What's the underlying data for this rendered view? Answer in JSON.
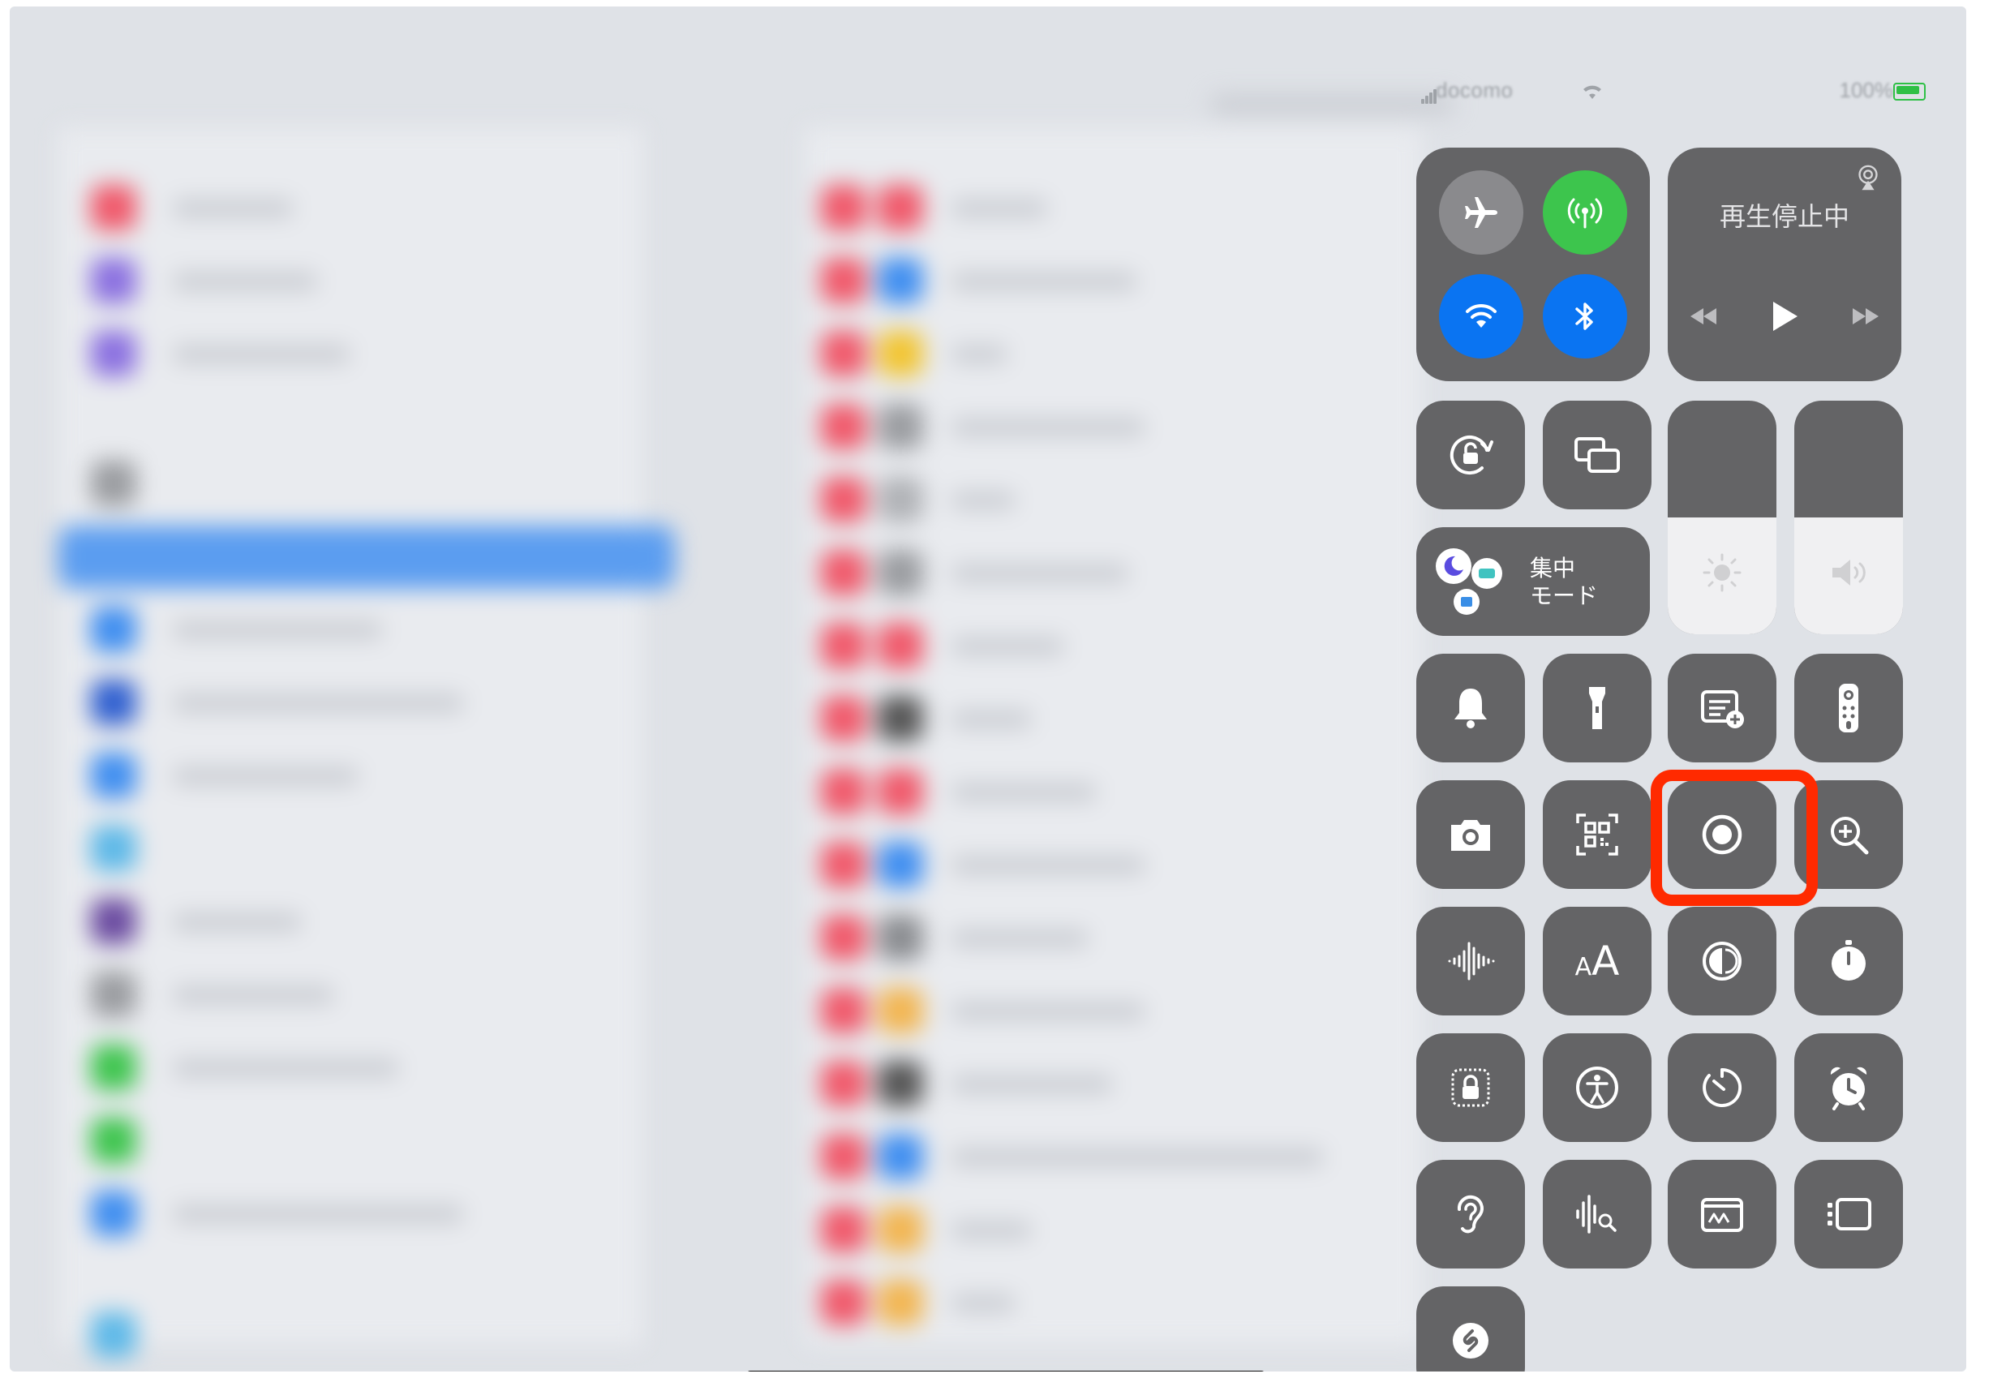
{
  "status_bar": {
    "carrier": "docomo",
    "battery": "100%"
  },
  "connectivity": {
    "airplane": {
      "state": "off"
    },
    "cellular": {
      "state": "on",
      "color": "#3dc54d"
    },
    "wifi": {
      "state": "on",
      "color": "#0a74f2"
    },
    "bluetooth": {
      "state": "on",
      "color": "#0a74f2"
    }
  },
  "now_playing": {
    "status": "再生停止中"
  },
  "focus": {
    "label_line1": "集中",
    "label_line2": "モード"
  },
  "brightness": {
    "level": 0.5
  },
  "volume": {
    "level": 0.5
  },
  "text_size_label": "AA",
  "highlight": {
    "target": "screen-recording",
    "color": "#ff2a00"
  },
  "tiles": [
    "orientation-lock",
    "screen-mirroring",
    "bell",
    "flashlight",
    "quick-note",
    "apple-tv-remote",
    "camera",
    "code-scanner",
    "screen-recording",
    "magnifier",
    "voice-memo",
    "text-size",
    "dark-mode",
    "stopwatch",
    "guided-access",
    "accessibility-shortcuts",
    "timer",
    "alarm",
    "hearing",
    "sound-recognition",
    "notes-markup",
    "stage-manager",
    "shazam"
  ]
}
